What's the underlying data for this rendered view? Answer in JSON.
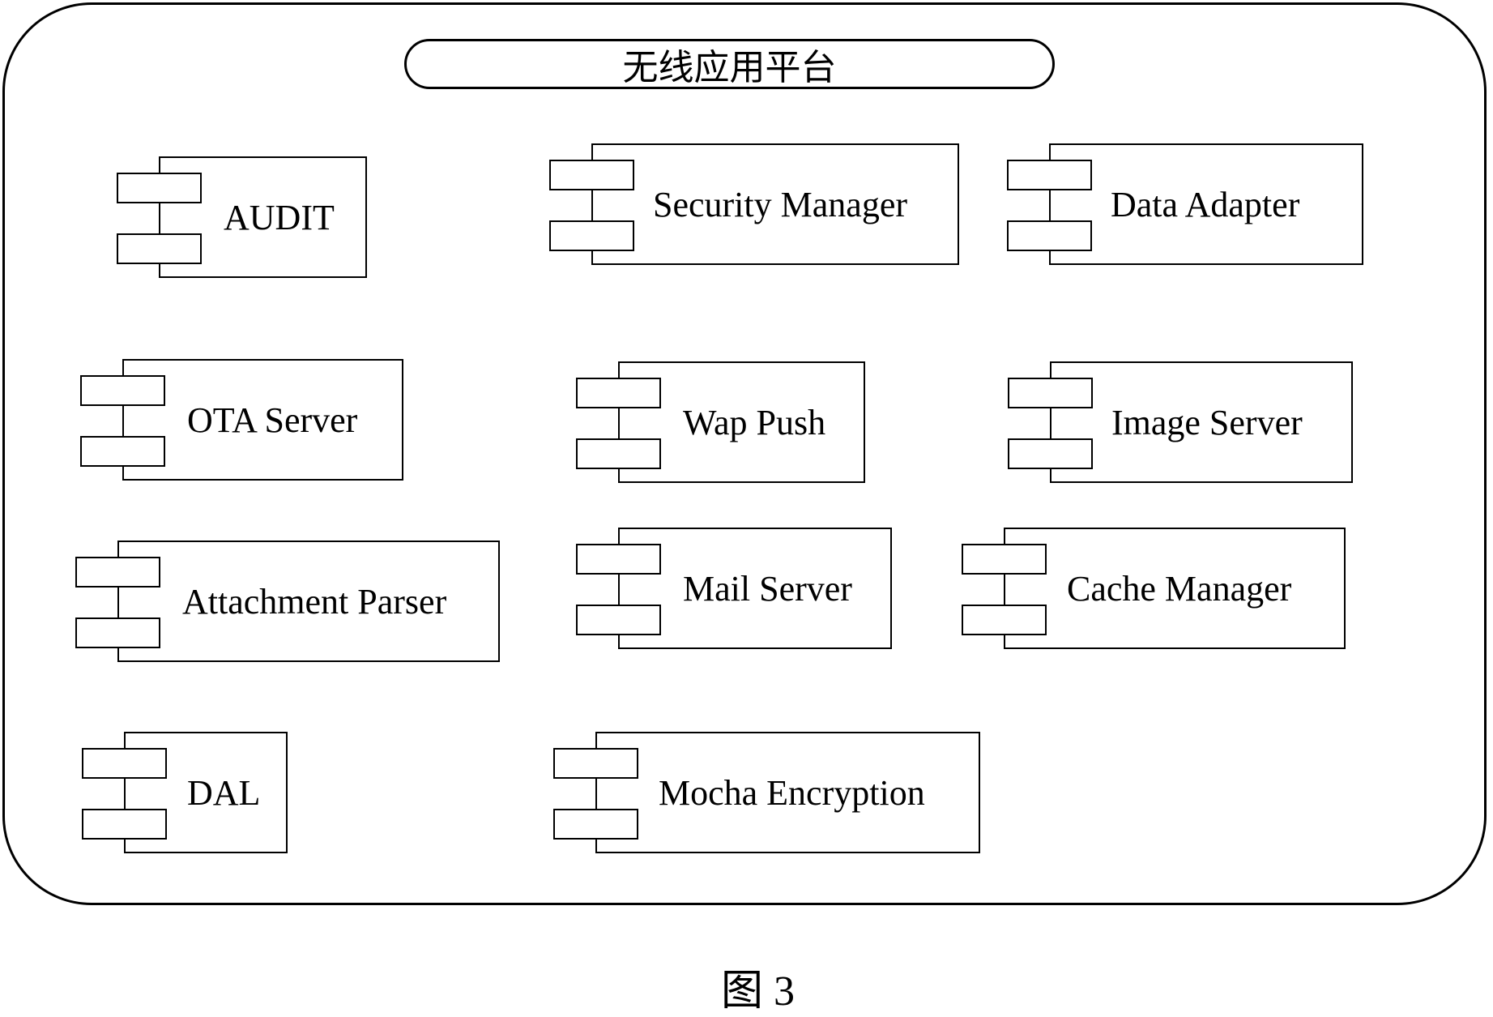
{
  "platform": {
    "title": "无线应用平台"
  },
  "components": [
    {
      "id": "audit",
      "label": "AUDIT"
    },
    {
      "id": "security-manager",
      "label": "Security Manager"
    },
    {
      "id": "data-adapter",
      "label": "Data  Adapter"
    },
    {
      "id": "ota-server",
      "label": "OTA Server"
    },
    {
      "id": "wap-push",
      "label": "Wap Push"
    },
    {
      "id": "image-server",
      "label": "Image Server"
    },
    {
      "id": "attachment-parser",
      "label": "Attachment Parser"
    },
    {
      "id": "mail-server",
      "label": "Mail Server"
    },
    {
      "id": "cache-manager",
      "label": "Cache Manager"
    },
    {
      "id": "dal",
      "label": "DAL"
    },
    {
      "id": "mocha-encryption",
      "label": "Mocha Encryption"
    }
  ],
  "caption": "图 3"
}
